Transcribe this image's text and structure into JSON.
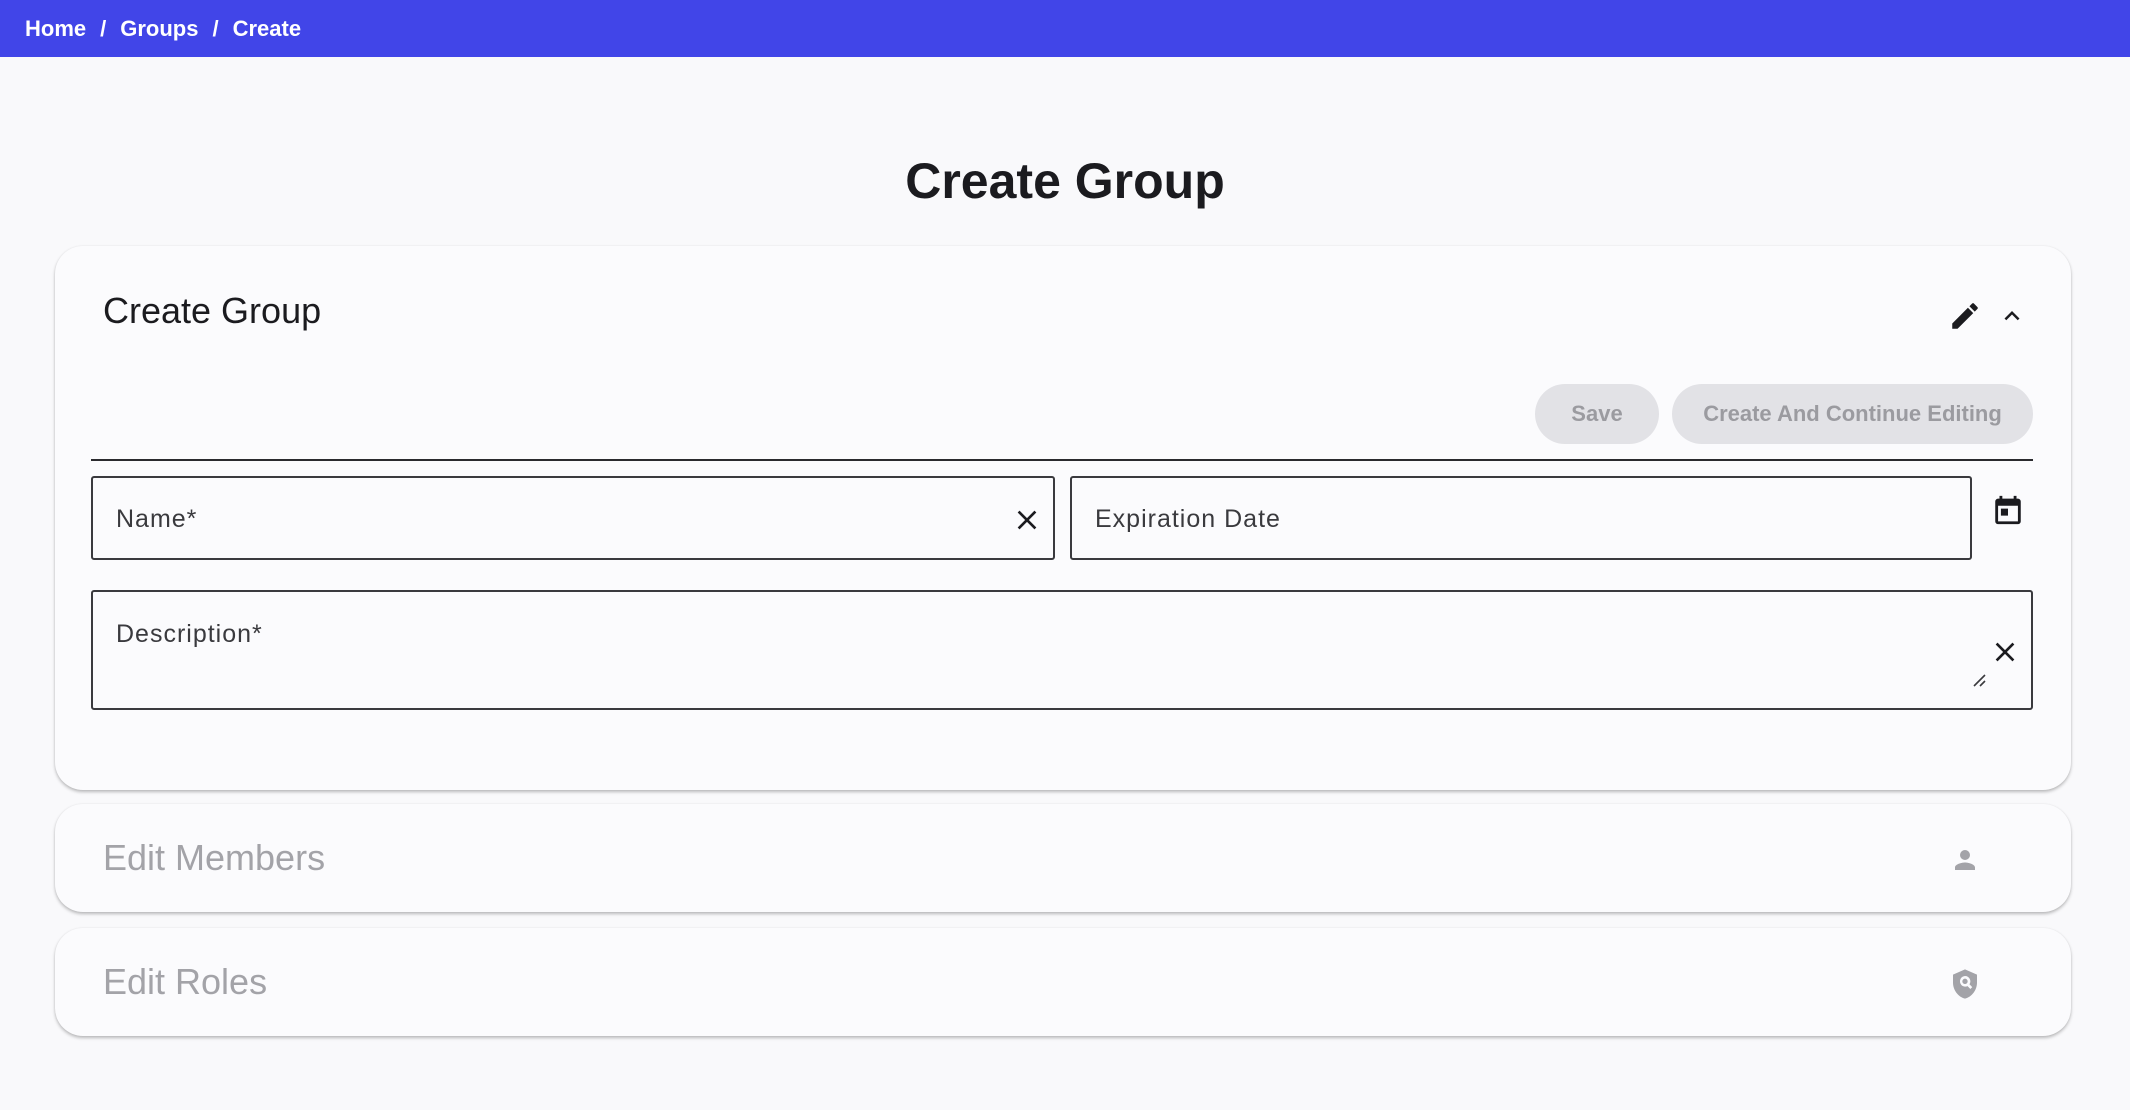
{
  "breadcrumb": {
    "items": [
      "Home",
      "Groups",
      "Create"
    ],
    "separator": "/"
  },
  "page": {
    "title": "Create Group"
  },
  "create_card": {
    "title": "Create Group",
    "save_label": "Save",
    "continue_label": "Create And Continue Editing",
    "fields": {
      "name_label": "Name*",
      "name_value": "",
      "expiration_label": "Expiration Date",
      "expiration_value": "",
      "description_label": "Description*",
      "description_value": ""
    }
  },
  "members_card": {
    "title": "Edit Members",
    "icon": "person-icon"
  },
  "roles_card": {
    "title": "Edit Roles",
    "icon": "shield-search-icon"
  },
  "colors": {
    "topbar": "#4145e8",
    "disabled_button_bg": "#e2e2e6",
    "disabled_text": "#9b9ba0"
  }
}
